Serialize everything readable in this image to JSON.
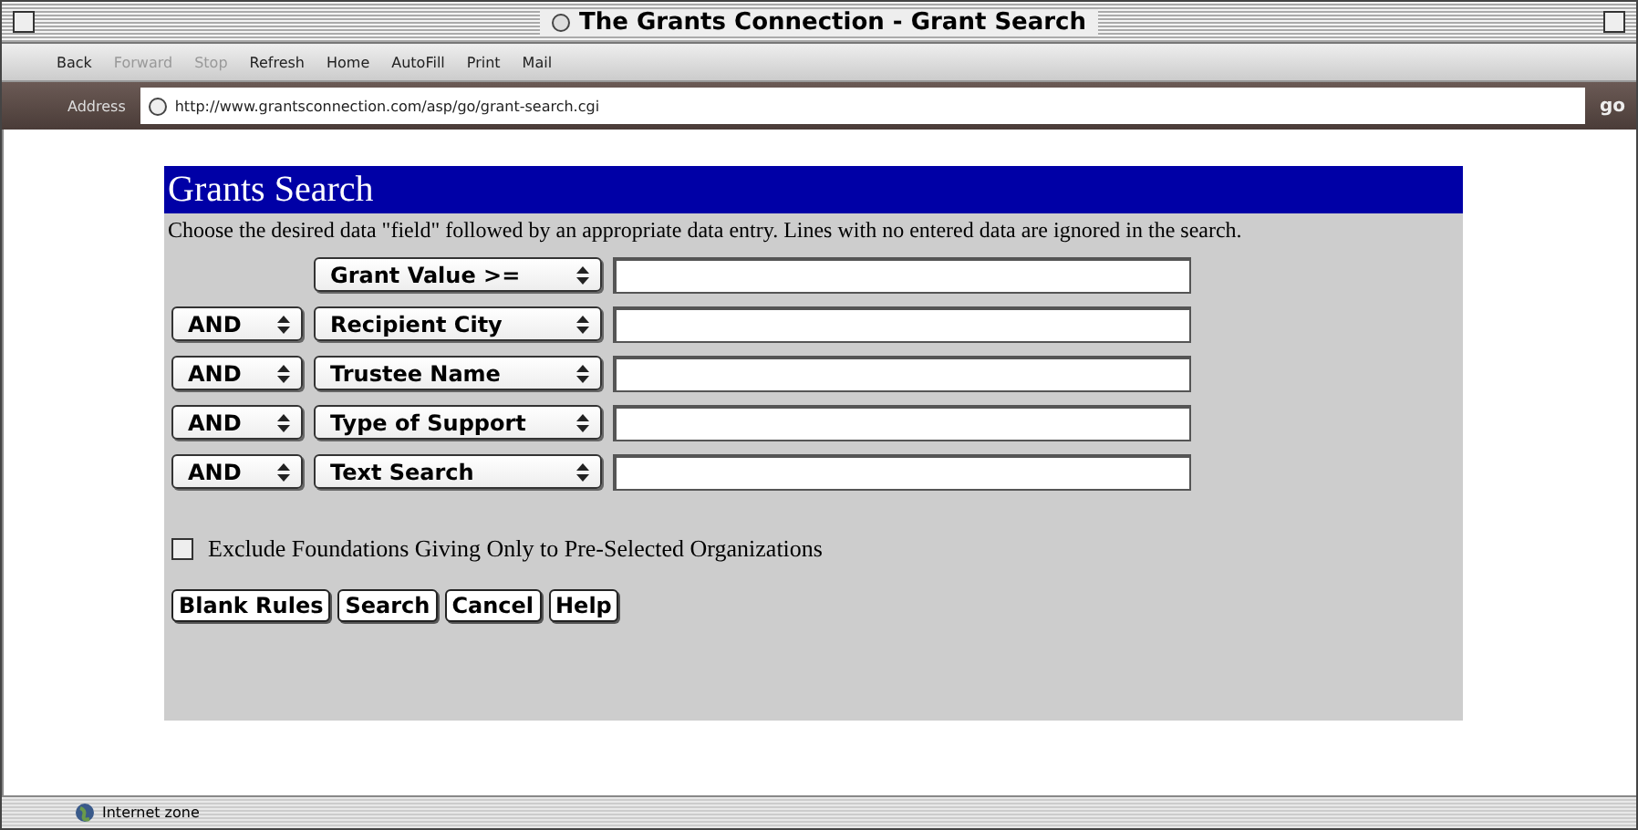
{
  "window": {
    "title": "The Grants Connection - Grant Search"
  },
  "toolbar": [
    {
      "label": "Back",
      "disabled": false
    },
    {
      "label": "Forward",
      "disabled": true
    },
    {
      "label": "Stop",
      "disabled": true
    },
    {
      "label": "Refresh",
      "disabled": false
    },
    {
      "label": "Home",
      "disabled": false
    },
    {
      "label": "AutoFill",
      "disabled": false
    },
    {
      "label": "Print",
      "disabled": false
    },
    {
      "label": "Mail",
      "disabled": false
    }
  ],
  "address_bar": {
    "label": "Address",
    "url": "http://www.grantsconnection.com/asp/go/grant-search.cgi",
    "go": "go"
  },
  "form": {
    "title": "Grants Search",
    "instructions": "Choose the desired data \"field\" followed by an appropriate data entry. Lines with no entered data are ignored in the search.",
    "rows": [
      {
        "field": "Grant Value >="
      },
      {
        "connector": "AND",
        "field": "Recipient City"
      },
      {
        "connector": "AND",
        "field": "Trustee Name"
      },
      {
        "connector": "AND",
        "field": "Type of Support"
      },
      {
        "connector": "AND",
        "field": "Text Search"
      }
    ],
    "checkbox": {
      "label": "Exclude Foundations Giving Only to Pre-Selected Organizations",
      "checked": false
    },
    "buttons": [
      "Blank Rules",
      "Search",
      "Cancel",
      "Help"
    ]
  },
  "status_bar": {
    "text": "Internet zone"
  }
}
